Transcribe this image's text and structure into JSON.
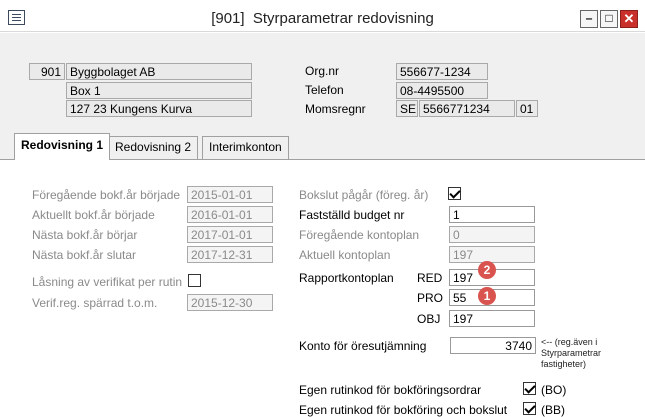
{
  "window": {
    "title": "[901]  Styrparametrar redovisning",
    "minimize_glyph": "‒",
    "maximize_glyph": "□",
    "close_glyph": "✕"
  },
  "header": {
    "company_number": "901",
    "company_name": "Byggbolaget AB",
    "address_line": "Box 1",
    "postal_line": "127 23  Kungens Kurva",
    "orgnr_label": "Org.nr",
    "orgnr_value": "556677-1234",
    "phone_label": "Telefon",
    "phone_value": "08-4495500",
    "vat_label": "Momsregnr",
    "vat_country": "SE",
    "vat_number": "5566771234",
    "vat_suffix": "01"
  },
  "tabs": [
    {
      "label": "Redovisning 1",
      "active": true
    },
    {
      "label": "Redovisning 2",
      "active": false
    },
    {
      "label": "Interimkonton",
      "active": false
    }
  ],
  "left": {
    "prev_fy_start_label": "Föregående bokf.år började",
    "prev_fy_start_value": "2015-01-01",
    "curr_fy_start_label": "Aktuellt bokf.år började",
    "curr_fy_start_value": "2016-01-01",
    "next_fy_start_label": "Nästa bokf.år börjar",
    "next_fy_start_value": "2017-01-01",
    "next_fy_end_label": "Nästa bokf.år slutar",
    "next_fy_end_value": "2017-12-31",
    "lock_label": "Låsning av verifikat per rutin",
    "lock_checked": false,
    "verif_lock_label": "Verif.reg. spärrad t.o.m.",
    "verif_lock_value": "2015-12-30"
  },
  "right": {
    "closing_label": "Bokslut pågår (föreg. år)",
    "closing_checked": true,
    "budget_label": "Fastställd budget nr",
    "budget_value": "1",
    "prev_chart_label": "Föregående kontoplan",
    "prev_chart_value": "0",
    "curr_chart_label": "Aktuell kontoplan",
    "curr_chart_value": "197",
    "report_chart_label": "Rapportkontoplan",
    "red_label": "RED",
    "red_value": "197",
    "pro_label": "PRO",
    "pro_value": "55",
    "obj_label": "OBJ",
    "obj_value": "197",
    "rounding_label": "Konto för öresutjämning",
    "rounding_value": "3740",
    "rounding_note": "<-- (reg.även i Styrparametrar fastigheter)",
    "own_routine_label": "Egen rutinkod för bokföringsordrar",
    "own_routine_checked": true,
    "own_routine_code": "(BO)",
    "own_routine2_label": "Egen rutinkod för bokföring och bokslut",
    "own_routine2_checked": true,
    "own_routine2_code": "(BB)"
  },
  "badges": {
    "badge1": "2",
    "badge2": "1"
  },
  "colors": {
    "badge": "#d9534f",
    "close_button": "#c9302c"
  }
}
